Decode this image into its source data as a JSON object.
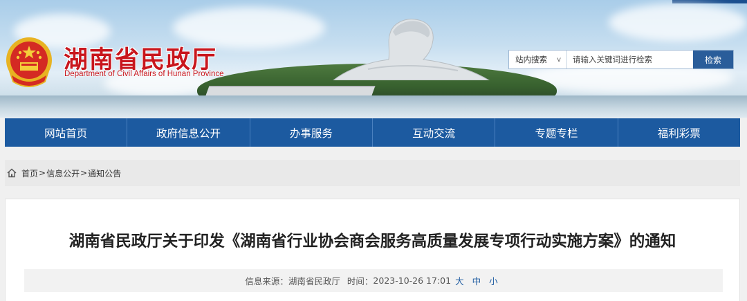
{
  "header": {
    "title": "湖南省民政厅",
    "subtitle": "Department of Civil Affairs of Hunan Province",
    "emblem_icon": "national-emblem-icon"
  },
  "search": {
    "scope": "站内搜索",
    "scope_chevron": "v",
    "placeholder": "请输入关键词进行检索",
    "button": "检索"
  },
  "nav": {
    "items": [
      {
        "label": "网站首页"
      },
      {
        "label": "政府信息公开"
      },
      {
        "label": "办事服务"
      },
      {
        "label": "互动交流"
      },
      {
        "label": "专题专栏"
      },
      {
        "label": "福利彩票"
      }
    ]
  },
  "breadcrumb": {
    "icon": "home-icon",
    "items": [
      "首页",
      "信息公开",
      "通知公告"
    ],
    "separator": ">"
  },
  "article": {
    "title": "湖南省民政厅关于印发《湖南省行业协会商会服务高质量发展专项行动实施方案》的通知",
    "source_label": "信息来源：",
    "source": "湖南省民政厅",
    "time_label": "时间：",
    "time": "2023-10-26 17:01",
    "font_sizes": [
      "大",
      "中",
      "小"
    ]
  },
  "colors": {
    "brand_red": "#c8161d",
    "nav_blue": "#1c5aa0",
    "search_button": "#2a5d9a"
  }
}
